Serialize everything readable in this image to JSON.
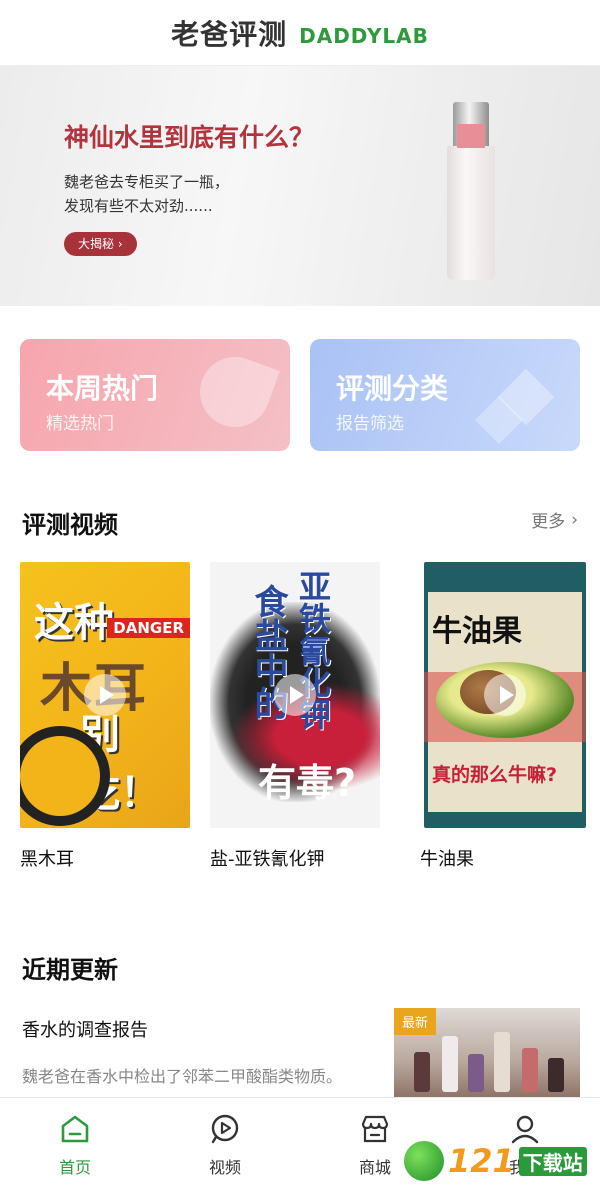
{
  "header": {
    "title_cn": "老爸评测",
    "title_en": "DADDYLAB"
  },
  "banner": {
    "title": "神仙水里到底有什么？",
    "desc_line1": "魏老爸去专柜买了一瓶，",
    "desc_line2": "发现有些不太对劲......",
    "button_label": "大揭秘",
    "button_icon": "chevron-right-icon"
  },
  "cards": [
    {
      "title": "本周热门",
      "subtitle": "精选热门"
    },
    {
      "title": "评测分类",
      "subtitle": "报告筛选"
    }
  ],
  "video_section": {
    "title": "评测视频",
    "more_label": "更多",
    "videos": [
      {
        "caption": "黑木耳",
        "thumb_text1": "这种",
        "thumb_badge": "DANGER",
        "thumb_text2": "木耳",
        "thumb_text3": "别吃！"
      },
      {
        "caption": "盐-亚铁氰化钾",
        "thumb_text1": "食盐中的",
        "thumb_text2": "亚铁氰化钾",
        "thumb_text3": "有毒?"
      },
      {
        "caption": "牛油果",
        "thumb_text1": "牛油果",
        "thumb_text2": "真的那么牛嘛?"
      }
    ]
  },
  "recent_section": {
    "title": "近期更新",
    "items": [
      {
        "title": "香水的调查报告",
        "desc": "魏老爸在香水中检出了邻苯二甲酸酯类物质。",
        "badge": "最新"
      }
    ]
  },
  "tabbar": {
    "tabs": [
      {
        "label": "首页",
        "icon": "home-icon",
        "active": true
      },
      {
        "label": "视频",
        "icon": "play-circle-icon",
        "active": false
      },
      {
        "label": "商城",
        "icon": "store-icon",
        "active": false
      },
      {
        "label": "我的",
        "icon": "user-icon",
        "active": false
      }
    ]
  },
  "watermark": {
    "number": "121",
    "text": "下载站"
  },
  "colors": {
    "accent_green": "#2e9a3e",
    "banner_red": "#b3343d",
    "hot_card": "#f7a5ad",
    "category_card": "#a9c2f5"
  }
}
